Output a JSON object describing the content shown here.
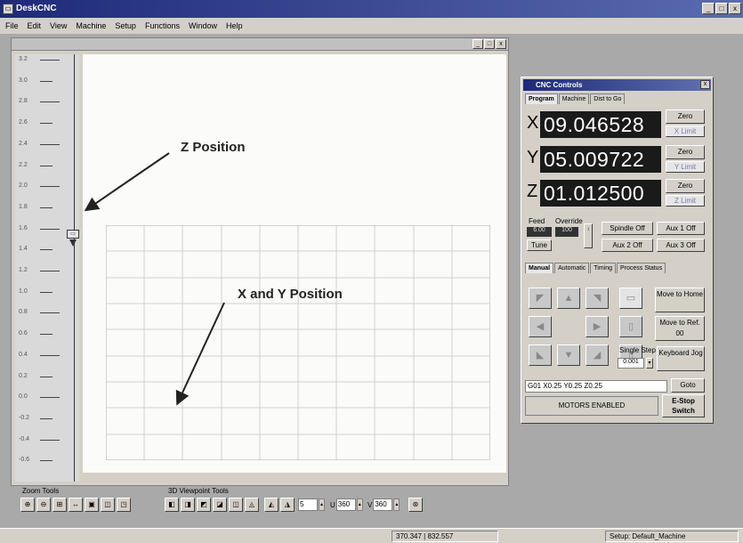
{
  "app": {
    "title": "DeskCNC",
    "icon_glyph": "▭"
  },
  "menu": [
    "File",
    "Edit",
    "View",
    "Machine",
    "Setup",
    "Functions",
    "Window",
    "Help"
  ],
  "window_controls": {
    "min": "_",
    "max": "□",
    "close": "x"
  },
  "z_ruler": {
    "labels": [
      "3.2",
      "3.0",
      "2.8",
      "2.6",
      "2.4",
      "2.2",
      "2.0",
      "1.8",
      "1.6",
      "1.4",
      "1.2",
      "1.0",
      "0.8",
      "0.6",
      "0.4",
      "0.2",
      "0.0",
      "-0.2",
      "-0.4",
      "-0.6"
    ]
  },
  "annotations": {
    "z_position": "Z Position",
    "xy_position": "X and Y Position"
  },
  "zoom_tools": {
    "label": "Zoom Tools",
    "buttons": [
      "⊕",
      "⊖",
      "⊞",
      "↔",
      "▣",
      "◫",
      "◳"
    ]
  },
  "viewpoint_tools": {
    "label": "3D Viewpoint Tools",
    "buttons": [
      "◧",
      "◨",
      "◩",
      "◪",
      "◫",
      "◬",
      "◭",
      "◮"
    ],
    "spin1_value": "5",
    "spin2_label": "U",
    "spin2_value": "360",
    "spin3_label": "V",
    "spin3_value": "360",
    "end_button": "⊛"
  },
  "statusbar": {
    "coords": "370.347 | 832.557",
    "setup": "Setup: Default_Machine"
  },
  "cnc": {
    "title": "CNC Controls",
    "tabs": [
      "Program",
      "Machine",
      "Dist to Go"
    ],
    "axes": [
      {
        "axis": "X",
        "value": "09.046528",
        "zero": "Zero",
        "limit": "X Limit"
      },
      {
        "axis": "Y",
        "value": "05.009722",
        "zero": "Zero",
        "limit": "Y Limit"
      },
      {
        "axis": "Z",
        "value": "01.012500",
        "zero": "Zero",
        "limit": "Z Limit"
      }
    ],
    "feed_label": "Feed",
    "feed_value": "6.00",
    "override_label": "Override",
    "override_value": "100",
    "tune_label": "Tune",
    "spindle": "Spindle Off",
    "aux1": "Aux 1 Off",
    "aux2": "Aux 2 Off",
    "aux3": "Aux 3 Off",
    "mode_tabs": [
      "Manual",
      "Automatic",
      "Timing",
      "Process Status"
    ],
    "jog_arrows": [
      "◤",
      "▲",
      "◥",
      "◀",
      "▶",
      "◣",
      "▼",
      "◢"
    ],
    "move_home": "Move to Home",
    "move_ref": "Move to Ref. 00",
    "single_step_label": "Single Step",
    "single_step_value": "0.001",
    "keyboard_jog": "Keyboard Jog",
    "gcode": "G01 X0.25 Y0.25 Z0.25",
    "goto": "Goto",
    "motors": "MOTORS ENABLED",
    "estop": "E-Stop Switch"
  }
}
